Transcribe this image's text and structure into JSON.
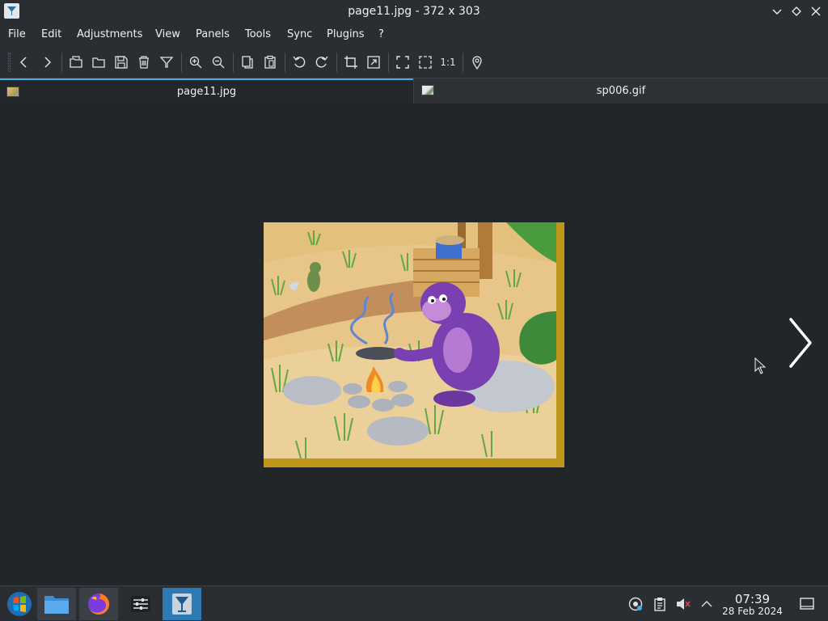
{
  "window": {
    "title": "page11.jpg - 372 x 303"
  },
  "menubar": {
    "items": [
      "File",
      "Edit",
      "Adjustments",
      "View",
      "Panels",
      "Tools",
      "Sync",
      "Plugins",
      "?"
    ]
  },
  "toolbar": {
    "buttons": [
      "previous-icon",
      "next-icon",
      "browse-icon",
      "open-icon",
      "save-icon",
      "delete-icon",
      "filter-icon",
      "zoom-in-icon",
      "zoom-out-icon",
      "copy-icon",
      "paste-icon",
      "rotate-left-icon",
      "rotate-right-icon",
      "crop-icon",
      "resize-icon",
      "fullscreen-icon",
      "fit-icon",
      "actual-size-icon",
      "location-icon"
    ],
    "actual_size_label": "1:1"
  },
  "tabs": [
    {
      "label": "page11.jpg",
      "active": true
    },
    {
      "label": "sp006.gif",
      "active": false
    }
  ],
  "viewer": {
    "image_name": "page11.jpg",
    "image_width": 372,
    "image_height": 303,
    "frame_color": "#c39a1e"
  },
  "taskbar": {
    "apps": [
      "start-menu-icon",
      "file-manager-icon",
      "firefox-icon",
      "settings-icon",
      "image-viewer-icon"
    ],
    "active_app": "image-viewer-icon"
  },
  "tray": {
    "icons": [
      "network-icon",
      "clipboard-icon",
      "volume-muted-icon",
      "chevron-up-icon",
      "show-desktop-icon"
    ]
  },
  "clock": {
    "time": "07:39",
    "date": "28 Feb 2024"
  },
  "colors": {
    "accent": "#3daee9",
    "background": "#2a2e32",
    "viewer_background": "#232629"
  }
}
